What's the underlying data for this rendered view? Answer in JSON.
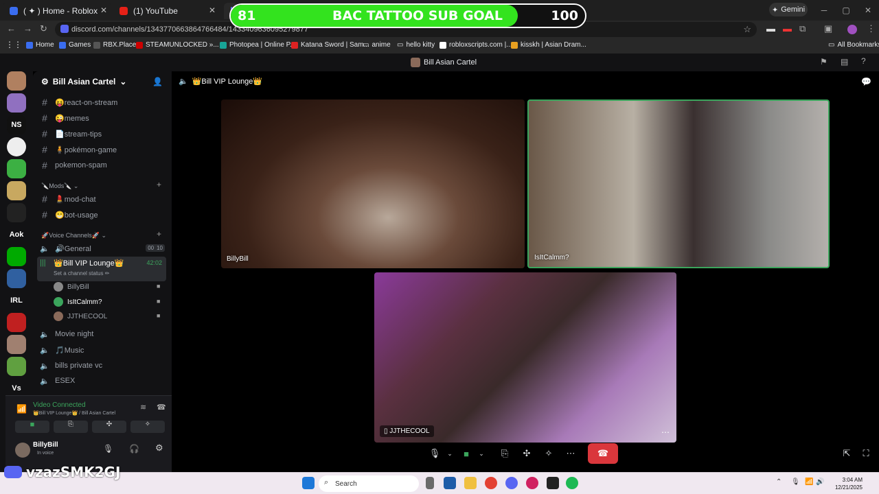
{
  "overlay": {
    "goal_current": "81",
    "goal_title": "BAC TATTOO SUB GOAL",
    "goal_target": "100",
    "progress": 0.81
  },
  "browser": {
    "tabs": [
      {
        "label": "( ✦ ) Home - Roblox",
        "color": "#3a6df0"
      },
      {
        "label": "(1) YouTube",
        "color": "#e62117"
      },
      {
        "label": "",
        "color": "#5865f2"
      }
    ],
    "gemini_label": "Gemini",
    "url": "discord.com/channels/1343770663864766484/1433409636095279877",
    "bookmarks": [
      "Home",
      "Games",
      "RBX.Place",
      "STEAMUNLOCKED »...",
      "Photopea | Online P...",
      "Katana Sword | Sam...",
      "anime",
      "hello kitty",
      "robloxscripts.com |...",
      "kisskh | Asian Dram..."
    ],
    "all_bookmarks": "All Bookmarks"
  },
  "discord": {
    "window_title": "Bill Asian Cartel",
    "server_name": "Bill Asian Cartel",
    "guild_labels": [
      "NS",
      "Aok",
      "IRL",
      "Vs"
    ],
    "channels": [
      {
        "name": "😝react-on-stream"
      },
      {
        "name": "😜memes"
      },
      {
        "name": "📄stream-tips"
      },
      {
        "name": "🧍pokémon-game"
      },
      {
        "name": "pokemon-spam"
      }
    ],
    "mods_category": "🔪Mods🔪",
    "mod_channels": [
      {
        "name": "💄mod-chat"
      },
      {
        "name": "😁bot-usage"
      }
    ],
    "voice_category": "🚀Voice Channels🚀",
    "voice_channels": {
      "general": "🔊General",
      "general_count_a": "00",
      "general_count_b": "10",
      "vip": "👑Bill VIP Lounge👑",
      "vip_time": "42:02",
      "vip_status": "Set a channel status ✏",
      "members": [
        "BillyBill",
        "IsItCalmm?",
        "JJTHECOOL"
      ],
      "others": [
        "Movie night",
        "🎵Music",
        "bills private vc",
        "ESEX"
      ]
    },
    "voice_panel": {
      "status": "Video Connected",
      "location": "👑Bill VIP Lounge👑 / Bill Asian Cartel"
    },
    "user": {
      "name": "BillyBill",
      "status": "In voice"
    },
    "call_header": "👑Bill VIP Lounge👑",
    "tiles": [
      "BillyBill",
      "IsItCalmm?",
      "JJTHECOOL"
    ]
  },
  "watermark": "vzazSMK2GJ",
  "taskbar": {
    "search": "Search",
    "time": "3:04 AM",
    "date": "12/21/2025"
  }
}
